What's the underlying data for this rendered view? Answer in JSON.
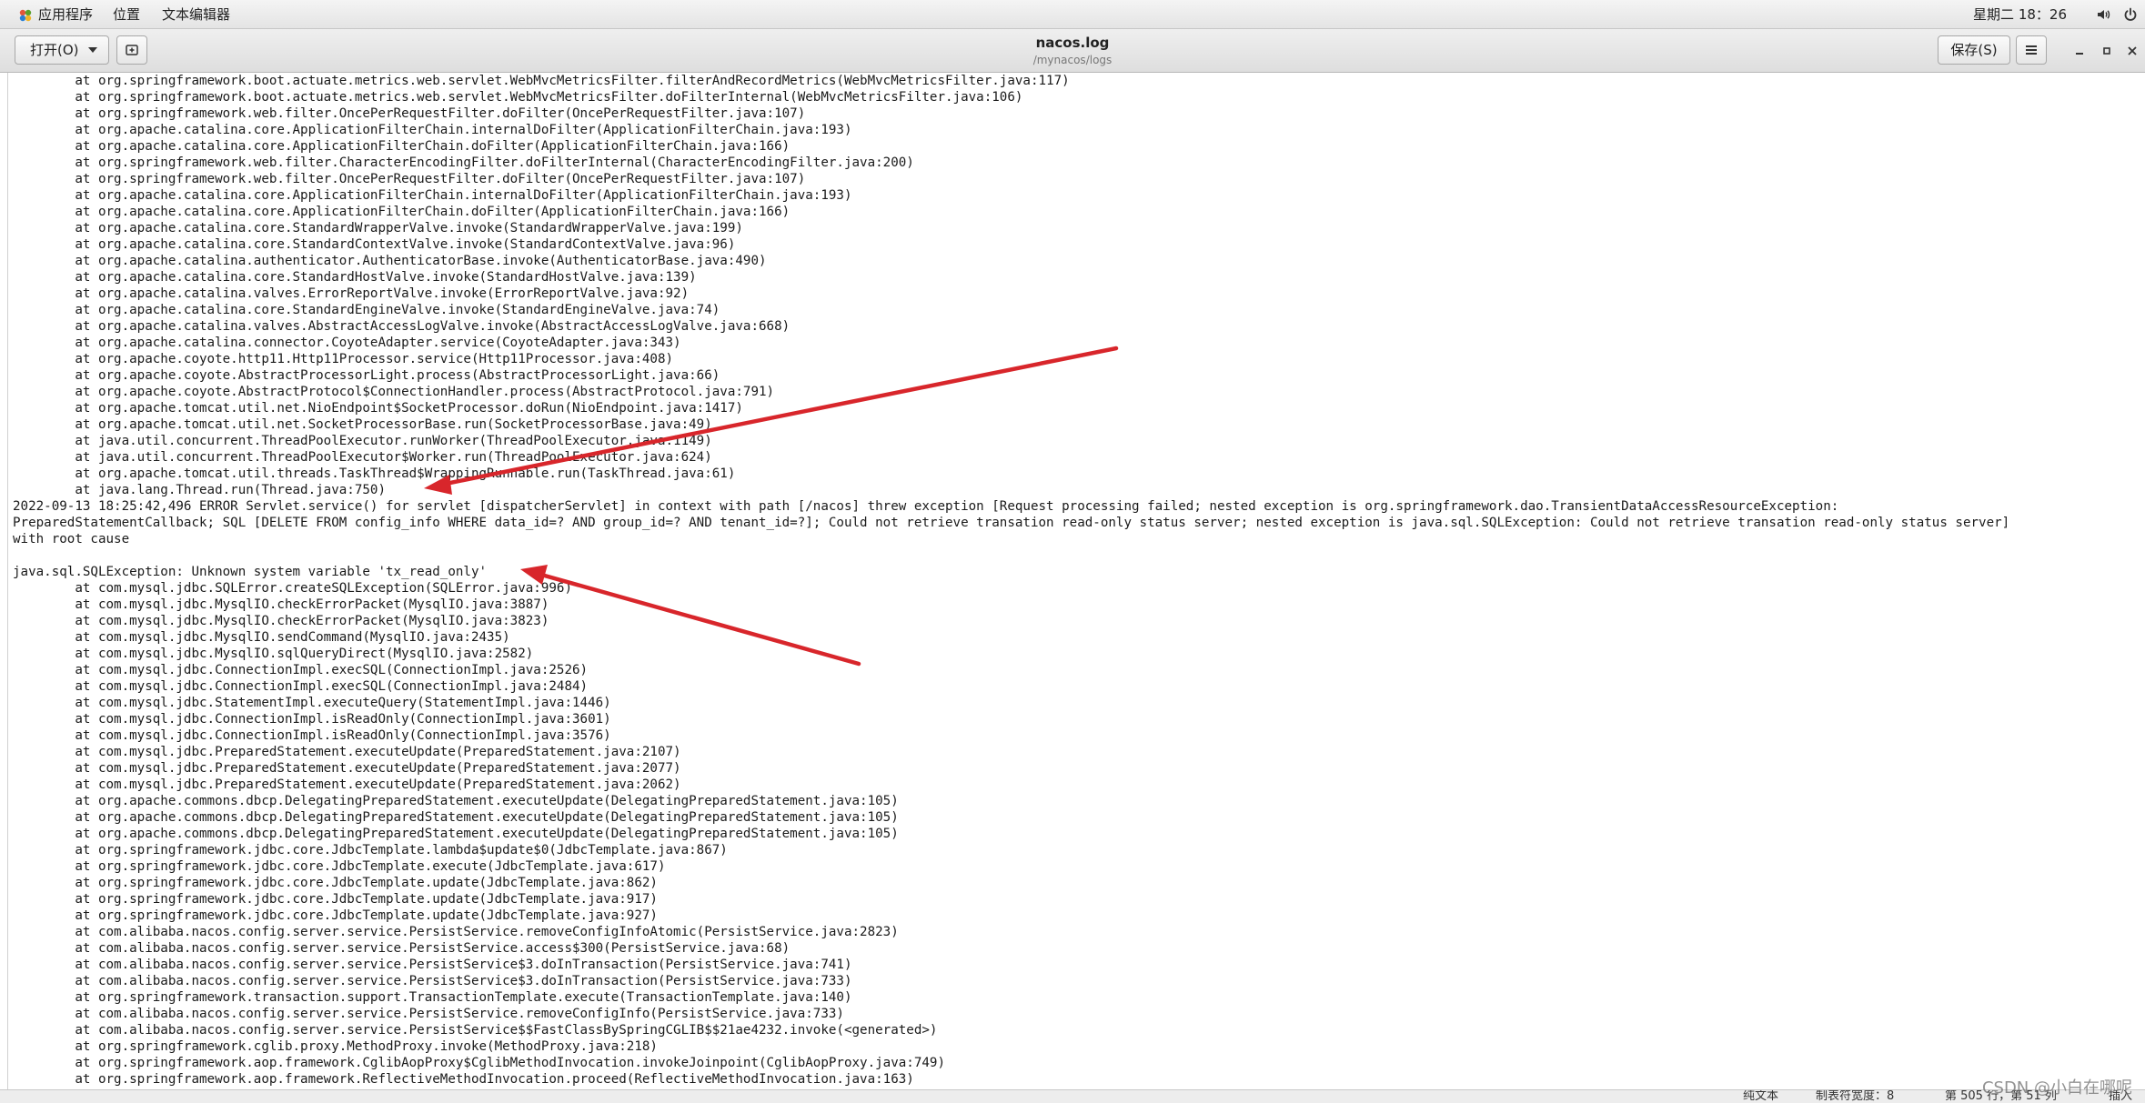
{
  "top_panel": {
    "applications": "应用程序",
    "places": "位置",
    "app_name": "文本编辑器",
    "clock": "星期二 18：26"
  },
  "header": {
    "open_label": "打开(O)",
    "title": "nacos.log",
    "path": "/mynacos/logs",
    "save_label": "保存(S)"
  },
  "log_lines": [
    "        at org.springframework.boot.actuate.metrics.web.servlet.WebMvcMetricsFilter.filterAndRecordMetrics(WebMvcMetricsFilter.java:117)",
    "        at org.springframework.boot.actuate.metrics.web.servlet.WebMvcMetricsFilter.doFilterInternal(WebMvcMetricsFilter.java:106)",
    "        at org.springframework.web.filter.OncePerRequestFilter.doFilter(OncePerRequestFilter.java:107)",
    "        at org.apache.catalina.core.ApplicationFilterChain.internalDoFilter(ApplicationFilterChain.java:193)",
    "        at org.apache.catalina.core.ApplicationFilterChain.doFilter(ApplicationFilterChain.java:166)",
    "        at org.springframework.web.filter.CharacterEncodingFilter.doFilterInternal(CharacterEncodingFilter.java:200)",
    "        at org.springframework.web.filter.OncePerRequestFilter.doFilter(OncePerRequestFilter.java:107)",
    "        at org.apache.catalina.core.ApplicationFilterChain.internalDoFilter(ApplicationFilterChain.java:193)",
    "        at org.apache.catalina.core.ApplicationFilterChain.doFilter(ApplicationFilterChain.java:166)",
    "        at org.apache.catalina.core.StandardWrapperValve.invoke(StandardWrapperValve.java:199)",
    "        at org.apache.catalina.core.StandardContextValve.invoke(StandardContextValve.java:96)",
    "        at org.apache.catalina.authenticator.AuthenticatorBase.invoke(AuthenticatorBase.java:490)",
    "        at org.apache.catalina.core.StandardHostValve.invoke(StandardHostValve.java:139)",
    "        at org.apache.catalina.valves.ErrorReportValve.invoke(ErrorReportValve.java:92)",
    "        at org.apache.catalina.core.StandardEngineValve.invoke(StandardEngineValve.java:74)",
    "        at org.apache.catalina.valves.AbstractAccessLogValve.invoke(AbstractAccessLogValve.java:668)",
    "        at org.apache.catalina.connector.CoyoteAdapter.service(CoyoteAdapter.java:343)",
    "        at org.apache.coyote.http11.Http11Processor.service(Http11Processor.java:408)",
    "        at org.apache.coyote.AbstractProcessorLight.process(AbstractProcessorLight.java:66)",
    "        at org.apache.coyote.AbstractProtocol$ConnectionHandler.process(AbstractProtocol.java:791)",
    "        at org.apache.tomcat.util.net.NioEndpoint$SocketProcessor.doRun(NioEndpoint.java:1417)",
    "        at org.apache.tomcat.util.net.SocketProcessorBase.run(SocketProcessorBase.java:49)",
    "        at java.util.concurrent.ThreadPoolExecutor.runWorker(ThreadPoolExecutor.java:1149)",
    "        at java.util.concurrent.ThreadPoolExecutor$Worker.run(ThreadPoolExecutor.java:624)",
    "        at org.apache.tomcat.util.threads.TaskThread$WrappingRunnable.run(TaskThread.java:61)",
    "        at java.lang.Thread.run(Thread.java:750)",
    "2022-09-13 18:25:42,496 ERROR Servlet.service() for servlet [dispatcherServlet] in context with path [/nacos] threw exception [Request processing failed; nested exception is org.springframework.dao.TransientDataAccessResourceException:",
    "PreparedStatementCallback; SQL [DELETE FROM config_info WHERE data_id=? AND group_id=? AND tenant_id=?]; Could not retrieve transation read-only status server; nested exception is java.sql.SQLException: Could not retrieve transation read-only status server]",
    "with root cause",
    "",
    "java.sql.SQLException: Unknown system variable 'tx_read_only'",
    "        at com.mysql.jdbc.SQLError.createSQLException(SQLError.java:996)",
    "        at com.mysql.jdbc.MysqlIO.checkErrorPacket(MysqlIO.java:3887)",
    "        at com.mysql.jdbc.MysqlIO.checkErrorPacket(MysqlIO.java:3823)",
    "        at com.mysql.jdbc.MysqlIO.sendCommand(MysqlIO.java:2435)",
    "        at com.mysql.jdbc.MysqlIO.sqlQueryDirect(MysqlIO.java:2582)",
    "        at com.mysql.jdbc.ConnectionImpl.execSQL(ConnectionImpl.java:2526)",
    "        at com.mysql.jdbc.ConnectionImpl.execSQL(ConnectionImpl.java:2484)",
    "        at com.mysql.jdbc.StatementImpl.executeQuery(StatementImpl.java:1446)",
    "        at com.mysql.jdbc.ConnectionImpl.isReadOnly(ConnectionImpl.java:3601)",
    "        at com.mysql.jdbc.ConnectionImpl.isReadOnly(ConnectionImpl.java:3576)",
    "        at com.mysql.jdbc.PreparedStatement.executeUpdate(PreparedStatement.java:2107)",
    "        at com.mysql.jdbc.PreparedStatement.executeUpdate(PreparedStatement.java:2077)",
    "        at com.mysql.jdbc.PreparedStatement.executeUpdate(PreparedStatement.java:2062)",
    "        at org.apache.commons.dbcp.DelegatingPreparedStatement.executeUpdate(DelegatingPreparedStatement.java:105)",
    "        at org.apache.commons.dbcp.DelegatingPreparedStatement.executeUpdate(DelegatingPreparedStatement.java:105)",
    "        at org.apache.commons.dbcp.DelegatingPreparedStatement.executeUpdate(DelegatingPreparedStatement.java:105)",
    "        at org.springframework.jdbc.core.JdbcTemplate.lambda$update$0(JdbcTemplate.java:867)",
    "        at org.springframework.jdbc.core.JdbcTemplate.execute(JdbcTemplate.java:617)",
    "        at org.springframework.jdbc.core.JdbcTemplate.update(JdbcTemplate.java:862)",
    "        at org.springframework.jdbc.core.JdbcTemplate.update(JdbcTemplate.java:917)",
    "        at org.springframework.jdbc.core.JdbcTemplate.update(JdbcTemplate.java:927)",
    "        at com.alibaba.nacos.config.server.service.PersistService.removeConfigInfoAtomic(PersistService.java:2823)",
    "        at com.alibaba.nacos.config.server.service.PersistService.access$300(PersistService.java:68)",
    "        at com.alibaba.nacos.config.server.service.PersistService$3.doInTransaction(PersistService.java:741)",
    "        at com.alibaba.nacos.config.server.service.PersistService$3.doInTransaction(PersistService.java:733)",
    "        at org.springframework.transaction.support.TransactionTemplate.execute(TransactionTemplate.java:140)",
    "        at com.alibaba.nacos.config.server.service.PersistService.removeConfigInfo(PersistService.java:733)",
    "        at com.alibaba.nacos.config.server.service.PersistService$$FastClassBySpringCGLIB$$21ae4232.invoke(<generated>)",
    "        at org.springframework.cglib.proxy.MethodProxy.invoke(MethodProxy.java:218)",
    "        at org.springframework.aop.framework.CglibAopProxy$CglibMethodInvocation.invokeJoinpoint(CglibAopProxy.java:749)",
    "        at org.springframework.aop.framework.ReflectiveMethodInvocation.proceed(ReflectiveMethodInvocation.java:163)"
  ],
  "status_bar": {
    "mode": "纯文本",
    "tab_width": "制表符宽度：8",
    "position": "第 505 行，第 51 列",
    "insert": "插入"
  },
  "watermark": "CSDN @小白在哪呢",
  "colors": {
    "annotation_arrow": "#d8262b",
    "panel_bg": "#e9e9e9",
    "text": "#1a1a1a"
  }
}
